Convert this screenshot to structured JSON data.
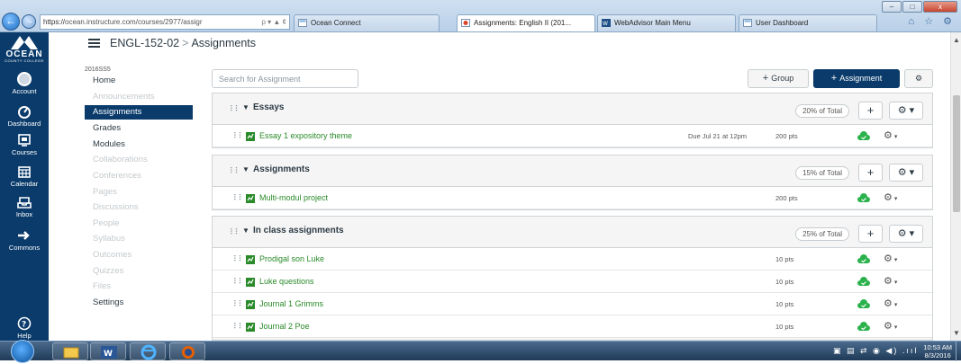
{
  "browser": {
    "url_scheme": "https://",
    "url_rest": "ocean.instructure.com/courses/2977/assigr",
    "url_controls": "ρ ▾ ▲ ¢",
    "tabs": [
      {
        "label": "Ocean Connect",
        "active": false
      },
      {
        "label": "Assignments: English II (201...",
        "active": true
      },
      {
        "label": "WebAdvisor Main Menu",
        "active": false
      },
      {
        "label": "User Dashboard",
        "active": false
      }
    ],
    "window_controls": {
      "minimize": "–",
      "maximize": "□",
      "close": "x"
    },
    "toolbar_icons": "⌂ ☆ ⚙"
  },
  "global_nav": {
    "logo_word": "OCEAN",
    "logo_sub": "COUNTY COLLEGE",
    "items": [
      {
        "label": "Account",
        "icon": "account-icon"
      },
      {
        "label": "Dashboard",
        "icon": "dashboard-icon"
      },
      {
        "label": "Courses",
        "icon": "courses-icon"
      },
      {
        "label": "Calendar",
        "icon": "calendar-icon"
      },
      {
        "label": "Inbox",
        "icon": "inbox-icon"
      },
      {
        "label": "Commons",
        "icon": "commons-icon"
      },
      {
        "label": "Help",
        "icon": "help-icon"
      }
    ]
  },
  "header": {
    "course_code": "ENGL-152-02",
    "separator": ">",
    "current_page": "Assignments"
  },
  "course_nav": {
    "term": "2016SS5",
    "items": [
      {
        "label": "Home",
        "state": "normal"
      },
      {
        "label": "Announcements",
        "state": "hidden"
      },
      {
        "label": "Assignments",
        "state": "active"
      },
      {
        "label": "Grades",
        "state": "normal"
      },
      {
        "label": "Modules",
        "state": "normal"
      },
      {
        "label": "Collaborations",
        "state": "hidden"
      },
      {
        "label": "Conferences",
        "state": "hidden"
      },
      {
        "label": "Pages",
        "state": "hidden"
      },
      {
        "label": "Discussions",
        "state": "hidden"
      },
      {
        "label": "People",
        "state": "hidden"
      },
      {
        "label": "Syllabus",
        "state": "hidden"
      },
      {
        "label": "Outcomes",
        "state": "hidden"
      },
      {
        "label": "Quizzes",
        "state": "hidden"
      },
      {
        "label": "Files",
        "state": "hidden"
      },
      {
        "label": "Settings",
        "state": "normal"
      }
    ]
  },
  "toolbar": {
    "search_placeholder": "Search for Assignment",
    "group_button_label": "Group",
    "assignment_button_label": "Assignment",
    "plus": "+"
  },
  "groups": [
    {
      "name": "Essays",
      "weight": "20% of Total",
      "assignments": [
        {
          "title": "Essay 1 expository theme",
          "due": "Due Jul 21 at 12pm",
          "points": "200 pts"
        }
      ]
    },
    {
      "name": "Assignments",
      "weight": "15% of Total",
      "assignments": [
        {
          "title": "Multi-modul project",
          "due": "",
          "points": "200 pts"
        }
      ]
    },
    {
      "name": "In class assignments",
      "weight": "25% of Total",
      "assignments": [
        {
          "title": "Prodigal son Luke",
          "due": "",
          "points": "10 pts"
        },
        {
          "title": "Luke questions",
          "due": "",
          "points": "10 pts"
        },
        {
          "title": "Journal 1 Grimms",
          "due": "",
          "points": "10 pts"
        },
        {
          "title": "Journal 2 Poe",
          "due": "",
          "points": "10 pts"
        }
      ]
    }
  ],
  "taskbar": {
    "time": "10:53 AM",
    "date": "8/3/2016",
    "tray_icons": "▣ ▤ ⇄ ◉ ◀) .ııl"
  },
  "colors": {
    "nav_blue": "#0a3b6b",
    "assignment_green": "#2a8a2a",
    "publish_green": "#2bb24c"
  }
}
